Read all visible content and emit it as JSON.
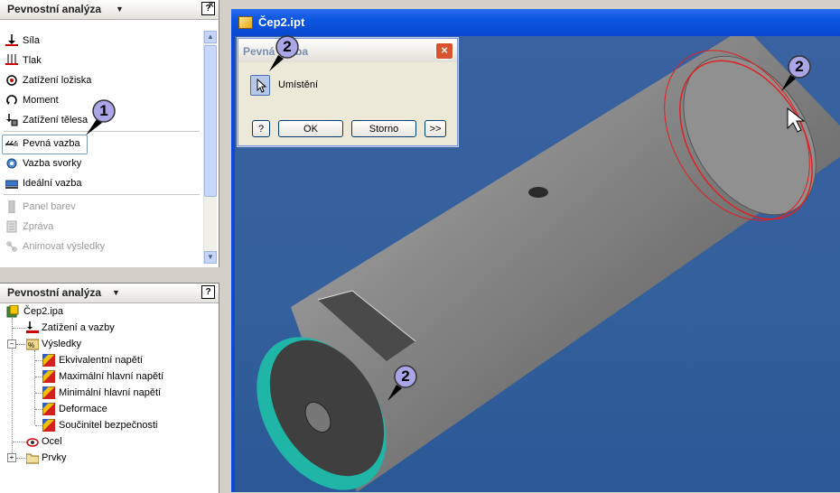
{
  "top_panel": {
    "title": "Pevnostní analýza",
    "commands": [
      {
        "label": "Síla",
        "icon": "force-icon",
        "enabled": true
      },
      {
        "label": "Tlak",
        "icon": "pressure-icon",
        "enabled": true
      },
      {
        "label": "Zatížení ložiska",
        "icon": "bearing-load-icon",
        "enabled": true
      },
      {
        "label": "Moment",
        "icon": "moment-icon",
        "enabled": true
      },
      {
        "label": "Zatížení tělesa",
        "icon": "body-load-icon",
        "enabled": true
      },
      {
        "label": "Pevná vazba",
        "icon": "fixed-constraint-icon",
        "enabled": true,
        "selected": true
      },
      {
        "label": "Vazba svorky",
        "icon": "pin-constraint-icon",
        "enabled": true
      },
      {
        "label": "Ideální vazba",
        "icon": "frictionless-constraint-icon",
        "enabled": true
      },
      {
        "label": "Panel barev",
        "icon": "color-bar-icon",
        "enabled": false
      },
      {
        "label": "Zpráva",
        "icon": "report-icon",
        "enabled": false
      },
      {
        "label": "Animovat výsledky",
        "icon": "animate-icon",
        "enabled": false
      }
    ]
  },
  "bottom_panel": {
    "title": "Pevnostní analýza",
    "tree": {
      "root": "Čep2.ipa",
      "loads": "Zatížení a vazby",
      "results": "Výsledky",
      "result_items": [
        "Ekvivalentní napětí",
        "Maximální hlavní napětí",
        "Minimální hlavní napětí",
        "Deformace",
        "Součinitel bezpečnosti"
      ],
      "material": "Ocel",
      "features": "Prvky"
    }
  },
  "document": {
    "title": "Čep2.ipt"
  },
  "dialog": {
    "title": "Pevná vazba",
    "pick_label": "Umístění",
    "ok": "OK",
    "cancel": "Storno",
    "more": ">>",
    "help": "?"
  },
  "callouts": {
    "one": "1",
    "two": "2"
  },
  "colors": {
    "viewport": "#33609c",
    "selected_face": "#1fb6a8",
    "highlight_edge": "#e02020",
    "balloon": "#a9a5e6"
  }
}
